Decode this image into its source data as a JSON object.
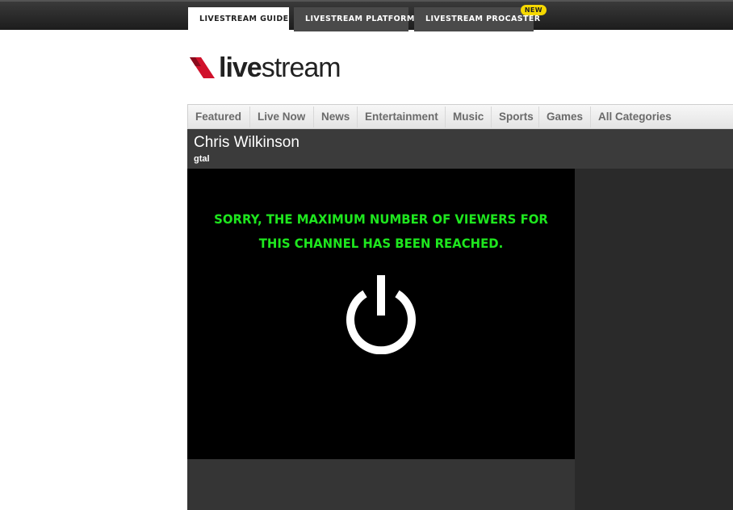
{
  "top_tabs": [
    {
      "label": "LIVESTREAM GUIDE"
    },
    {
      "label": "LIVESTREAM PLATFORM"
    },
    {
      "label": "LIVESTREAM PROCASTER",
      "badge": "NEW"
    }
  ],
  "logo": {
    "text_bold": "live",
    "text_regular": "stream"
  },
  "categories": [
    "Featured",
    "Live Now",
    "News",
    "Entertainment",
    "Music",
    "Sports",
    "Games",
    "All Categories"
  ],
  "channel": {
    "title": "Chris Wilkinson",
    "subtitle": "gtal"
  },
  "player": {
    "message_line1": "SORRY, THE MAXIMUM NUMBER OF VIEWERS FOR",
    "message_line2": "THIS CHANNEL HAS BEEN REACHED.",
    "icon": "power-icon"
  },
  "colors": {
    "brand_red": "#d0112b",
    "message_green": "#1ee61e",
    "badge_yellow": "#f5d800"
  }
}
